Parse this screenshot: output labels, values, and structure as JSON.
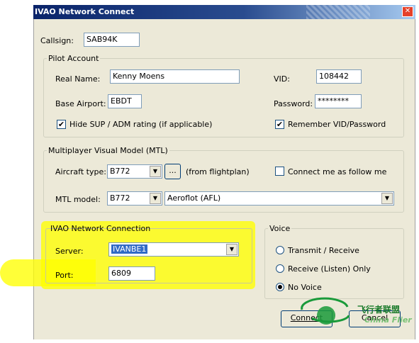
{
  "window": {
    "title": "IVAO Network Connect",
    "close_glyph": "✕"
  },
  "callsign": {
    "label": "Callsign:",
    "value": "SAB94K"
  },
  "pilot_account": {
    "legend": "Pilot Account",
    "real_name_label": "Real Name:",
    "real_name_value": "Kenny Moens",
    "vid_label": "VID:",
    "vid_value": "108442",
    "base_airport_label": "Base Airport:",
    "base_airport_value": "EBDT",
    "password_label": "Password:",
    "password_value": "********",
    "hide_sup_label": "Hide SUP / ADM rating (if applicable)",
    "hide_sup_checked": "✔",
    "remember_label": "Remember VID/Password",
    "remember_checked": "✔"
  },
  "mtl": {
    "legend": "Multiplayer Visual Model (MTL)",
    "aircraft_type_label": "Aircraft type:",
    "aircraft_type_value": "B772",
    "browse_label": "...",
    "from_flightplan": "(from flightplan)",
    "follow_label": "Connect me as follow me",
    "mtl_model_label": "MTL model:",
    "mtl_model_value": "B772",
    "airline_value": "Aeroflot (AFL)"
  },
  "network": {
    "legend": "IVAO Network Connection",
    "server_label": "Server:",
    "server_value": "IVANBE1",
    "port_label": "Port:",
    "port_value": "6809"
  },
  "voice": {
    "legend": "Voice",
    "options": [
      "Transmit / Receive",
      "Receive (Listen) Only",
      "No Voice"
    ],
    "selected": "No Voice"
  },
  "buttons": {
    "connect": "Connect",
    "cancel": "Cancel"
  },
  "icons": {
    "dropdown": "▼"
  },
  "watermark": {
    "text_cn": "飞行者联盟",
    "text_en": "China Flier"
  },
  "colors": {
    "titlebar": "#0a246a",
    "highlight": "#ffff00",
    "face": "#ece9d8"
  }
}
